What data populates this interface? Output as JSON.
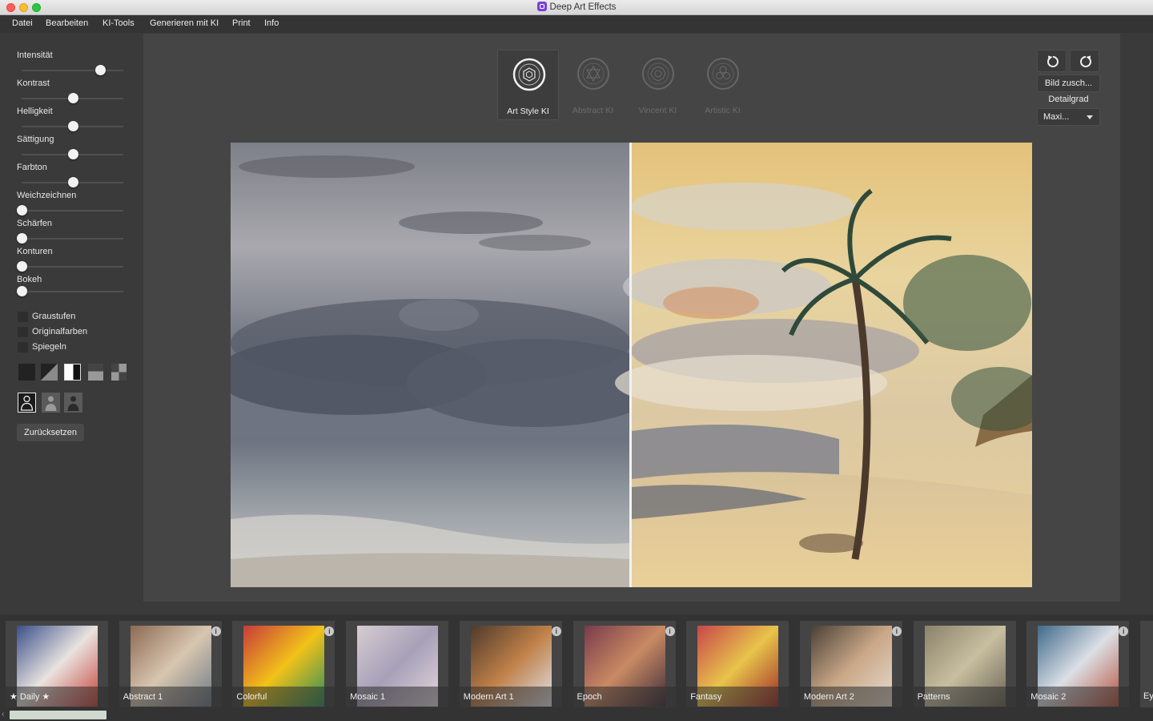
{
  "window": {
    "title": "Deep Art Effects"
  },
  "menu": [
    "Datei",
    "Bearbeiten",
    "KI-Tools",
    "Generieren mit KI",
    "Print",
    "Info"
  ],
  "sliders": [
    {
      "label": "Intensität",
      "value": 0.77
    },
    {
      "label": "Kontrast",
      "value": 0.5
    },
    {
      "label": "Helligkeit",
      "value": 0.5
    },
    {
      "label": "Sättigung",
      "value": 0.5
    },
    {
      "label": "Farbton",
      "value": 0.5
    },
    {
      "label": "Weichzeichnen",
      "value": 0.0
    },
    {
      "label": "Schärfen",
      "value": 0.0
    },
    {
      "label": "Konturen",
      "value": 0.0
    },
    {
      "label": "Bokeh",
      "value": 0.0
    }
  ],
  "checkboxes": [
    {
      "label": "Graustufen",
      "checked": false
    },
    {
      "label": "Originalfarben",
      "checked": false
    },
    {
      "label": "Spiegeln",
      "checked": false
    }
  ],
  "blend_modes": [
    "blend-dark-icon",
    "blend-diagonal-icon",
    "blend-split-icon",
    "blend-corner-icon",
    "blend-quadrant-icon"
  ],
  "portrait_modes": [
    "portrait-outline-icon",
    "portrait-filled-icon",
    "portrait-solid-icon"
  ],
  "reset_label": "Zurücksetzen",
  "ai_modes": [
    {
      "label": "Art Style KI",
      "selected": true
    },
    {
      "label": "Abstract KI",
      "selected": false
    },
    {
      "label": "Vincent KI",
      "selected": false
    },
    {
      "label": "Artistic KI",
      "selected": false
    }
  ],
  "right_panel": {
    "undo_icon": "undo-icon",
    "redo_icon": "redo-icon",
    "crop_label": "Bild zusch...",
    "detail_label": "Detailgrad",
    "detail_value": "Maxi..."
  },
  "styles": [
    {
      "label": "★ Daily ★",
      "info": false
    },
    {
      "label": "Abstract 1",
      "info": true
    },
    {
      "label": "Colorful",
      "info": true
    },
    {
      "label": "Mosaic 1",
      "info": false
    },
    {
      "label": "Modern Art 1",
      "info": true
    },
    {
      "label": "Epoch",
      "info": true
    },
    {
      "label": "Fantasy",
      "info": false
    },
    {
      "label": "Modern Art 2",
      "info": true
    },
    {
      "label": "Patterns",
      "info": false
    },
    {
      "label": "Mosaic 2",
      "info": true
    }
  ],
  "styles_partial_label": "Ey",
  "colors": {
    "accent_knob": "#f2f2f2",
    "panel": "#454545",
    "bg": "#3a3a3a"
  }
}
